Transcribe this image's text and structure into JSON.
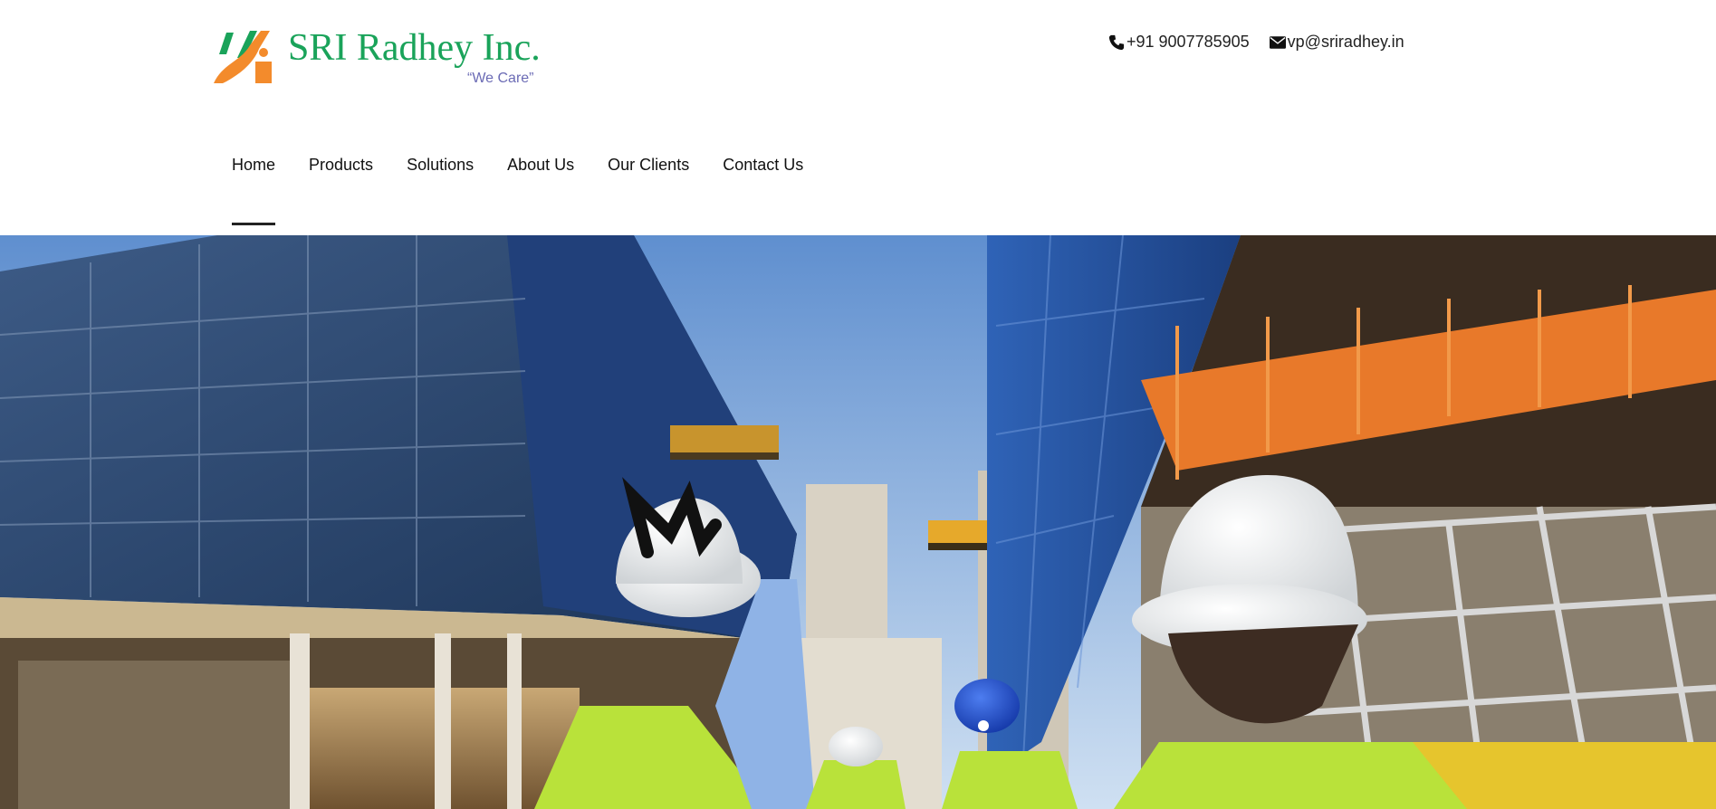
{
  "brand": {
    "name": "SRI Radhey Inc.",
    "tagline": "“We Care”",
    "colors": {
      "green": "#1aa35a",
      "orange": "#f38b2c",
      "tagline": "#6b6bb5"
    }
  },
  "contact": {
    "phone": "+91 9007785905",
    "email": "vp@sriradhey.in",
    "phone_icon": "phone-icon",
    "email_icon": "envelope-icon"
  },
  "nav": {
    "items": [
      {
        "label": "Home",
        "active": true
      },
      {
        "label": "Products",
        "active": false
      },
      {
        "label": "Solutions",
        "active": false
      },
      {
        "label": "About Us",
        "active": false
      },
      {
        "label": "Our Clients",
        "active": false
      },
      {
        "label": "Contact Us",
        "active": false
      }
    ]
  },
  "hero": {
    "image": "construction-site-workers-photo"
  }
}
